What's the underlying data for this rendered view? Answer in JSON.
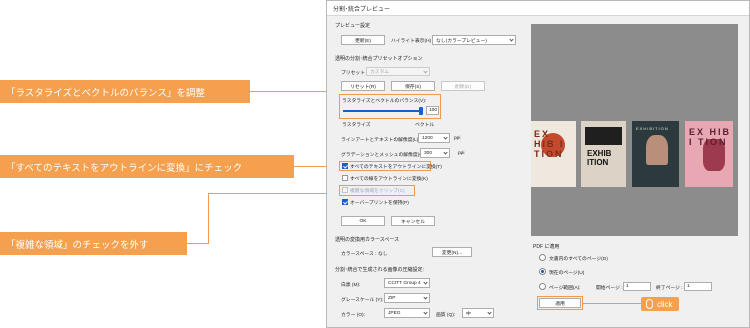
{
  "callouts": {
    "raster": "「ラスタライズとベクトルのバランス」を調整",
    "outline": "「すべてのテキストをアウトラインに変換」にチェック",
    "complex": "「複雑な領域」のチェックを外す"
  },
  "dialog": {
    "title": "分割･統合プレビュー",
    "preview_settings": {
      "section": "プレビュー設定",
      "refresh": "更新(E)",
      "highlight_label": "ハイライト表示(H)",
      "highlight_value": "なし(カラープレビュー)"
    },
    "transparency": {
      "section": "透明の分割･統合プリセットオプション",
      "preset_label": "プリセット :",
      "preset_value": "カスタム",
      "reset": "リセット(R)",
      "save": "保存(S)",
      "delete": "削除(D)",
      "balance_label": "ラスタライズとベクトルのバランス(V):",
      "balance_value": "100",
      "balance_fraction": 1.0,
      "raster_word": "ラスタライズ",
      "vector_word": "ベクトル",
      "line_art_label": "ラインアートとテキストの解像度(L):",
      "line_art_value": "1200",
      "gradient_label": "グラデーションとメッシュの解像度(G):",
      "gradient_value": "300",
      "ppi": "ppi",
      "opt_outline_text": "すべてのテキストをアウトラインに変換(T)",
      "opt_outline_strokes": "すべての線をアウトラインに変換(K)",
      "opt_clip": "複雑な領域をクリップ(C)",
      "opt_overprint": "オーバープリントを保持(P)",
      "ok": "OK",
      "cancel": "キャンセル"
    },
    "colorspace": {
      "section": "透明の変換用カラースペース",
      "label": "カラースペース :",
      "value": "なし",
      "change": "変更(N)..."
    },
    "compression": {
      "section": "分割･統合で生成される画像の圧縮設定:",
      "mono_label": "白黒 (M):",
      "mono_value": "CCITT Group 4",
      "gray_label": "グレースケール (Y):",
      "gray_value": "ZIP",
      "color_label": "カラー (O):",
      "color_value": "JPEG",
      "quality_label": "画質 (Q):",
      "quality_value": "中"
    },
    "apply_pdf": {
      "section": "PDF に適用",
      "opt_all": "文書内のすべてのページ(D)",
      "opt_current": "現在のページ(U)",
      "opt_range": "ページ範囲(A):",
      "start_label": "開始ページ :",
      "start_value": "1",
      "end_label": "終了ページ :",
      "end_value": "1",
      "apply": "適用"
    },
    "preview": {
      "thumbs": [
        {
          "kind": "exhibition-red",
          "text": "EX HIB I TION"
        },
        {
          "kind": "exhibition-collage",
          "text": "EXHIB ITION"
        },
        {
          "kind": "exhibition-art",
          "text": "EXHIBITION"
        },
        {
          "kind": "exhibition-pink",
          "text": "EX HIB I TION"
        }
      ]
    }
  },
  "click_badge": "click",
  "colors": {
    "accent": "#f5a04e",
    "check": "#1560c9",
    "preview_bg": "#8c8c8c"
  }
}
